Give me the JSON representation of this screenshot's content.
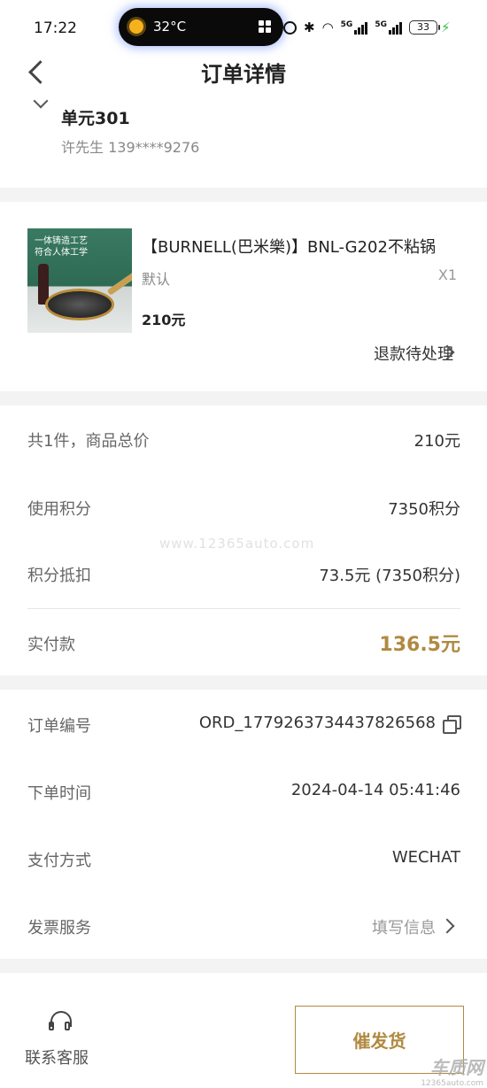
{
  "status_bar": {
    "time": "17:22",
    "temperature": "32°C",
    "signal_1": "5G",
    "signal_2": "5G",
    "battery": "33"
  },
  "header": {
    "title": "订单详情"
  },
  "address": {
    "unit": "单元301",
    "contact": "许先生 139****9276"
  },
  "product": {
    "image_text_1": "一体铸造工艺",
    "image_text_2": "符合人体工学",
    "name": "【BURNELL(巴米樂)】BNL-G202不粘锅",
    "spec": "默认",
    "quantity": "X1",
    "price": "210元",
    "refund_status": "退款待处理"
  },
  "summary": {
    "total_label": "共1件，商品总价",
    "total_value": "210元",
    "points_used_label": "使用积分",
    "points_used_value": "7350积分",
    "points_deduct_label": "积分抵扣",
    "points_deduct_value": "73.5元 (7350积分)",
    "paid_label": "实付款",
    "paid_value": "136.5元"
  },
  "order_info": {
    "order_no_label": "订单编号",
    "order_no_value": "ORD_1779263734437826568",
    "order_time_label": "下单时间",
    "order_time_value": "2024-04-14 05:41:46",
    "pay_method_label": "支付方式",
    "pay_method_value": "WECHAT",
    "invoice_label": "发票服务",
    "invoice_value": "填写信息"
  },
  "watermark": "www.12365auto.com",
  "footer": {
    "customer_service_label": "联系客服",
    "urge_button_label": "催发货",
    "corner_mark_1": "车质网",
    "corner_mark_2": "12365auto.com"
  },
  "colors": {
    "accent": "#b08a40",
    "separator": "#f3f3f3"
  }
}
